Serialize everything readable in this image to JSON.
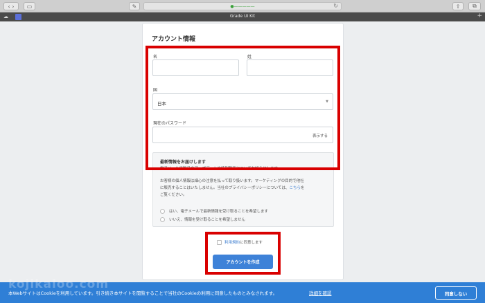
{
  "browser": {
    "tab_title": "Grade UI Kit",
    "address": "●—————"
  },
  "form": {
    "title": "アカウント情報",
    "first_name_label": "名",
    "last_name_label": "姓",
    "country_label": "国",
    "country_value": "日本",
    "password_label": "現在のパスワード",
    "show_password": "表示する"
  },
  "newsletter": {
    "title": "最新情報をお届けします",
    "line1": "電子メールで製品のアップデートや特別割引についてお知らせします。",
    "line2a": "お客様の個人情報は細心の注意を払って取り扱います。マーケティングの目的で他社",
    "line2b": "に販売することはいたしません。当社のプライバシーポリシーについては、",
    "link": "こちら",
    "line2c": "を",
    "line3": "ご覧ください。",
    "option_yes": "はい、電子メールで最新情報を受け取ることを希望します",
    "option_no": "いいえ、情報を受け取ることを希望しません"
  },
  "terms": {
    "link": "利用規約",
    "text": "に同意します"
  },
  "create_button": "アカウントを作成",
  "cookie": {
    "text": "本WebサイトはCookieを利用しています。引き続き本サイトを閲覧することで当社のCookieの利用に同意したものとみなされます。",
    "link": "詳細を確認",
    "button": "同意しない"
  },
  "watermark": "kojikaloo.com",
  "colors": {
    "accent": "#3e82d8",
    "highlight": "#d90000",
    "cookie_bar": "#2f7fd6"
  }
}
